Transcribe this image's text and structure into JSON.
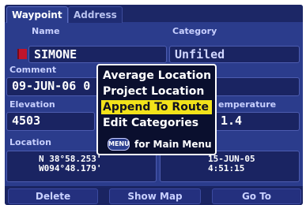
{
  "tabs": {
    "waypoint": "Waypoint",
    "address": "Address"
  },
  "fields": {
    "name": {
      "label": "Name",
      "value": "SIMONE"
    },
    "category": {
      "label": "Category",
      "value": "Unfiled"
    },
    "comment": {
      "label": "Comment",
      "value": "09-JUN-06 0"
    },
    "elevation": {
      "label": "Elevation",
      "value": "4503"
    },
    "temperature": {
      "label": "emperature",
      "value": "1.4"
    },
    "location": {
      "label": "Location",
      "lat": "N 38°58.253'",
      "lon": "W094°48.179'"
    },
    "datetime": {
      "date": "15-JUN-05",
      "time": "4:51:15"
    }
  },
  "menu": {
    "items": [
      "Average Location",
      "Project Location",
      "Append To Route",
      "Edit Categories"
    ],
    "selected_index": 2,
    "footer_button": "MENU",
    "footer_text": "for Main Menu"
  },
  "buttons": {
    "delete": "Delete",
    "show_map": "Show Map",
    "goto": "Go To"
  },
  "colors": {
    "background": "#2b3c8c",
    "highlight": "#f2e21a",
    "menu_bg": "#0a0f2e"
  }
}
